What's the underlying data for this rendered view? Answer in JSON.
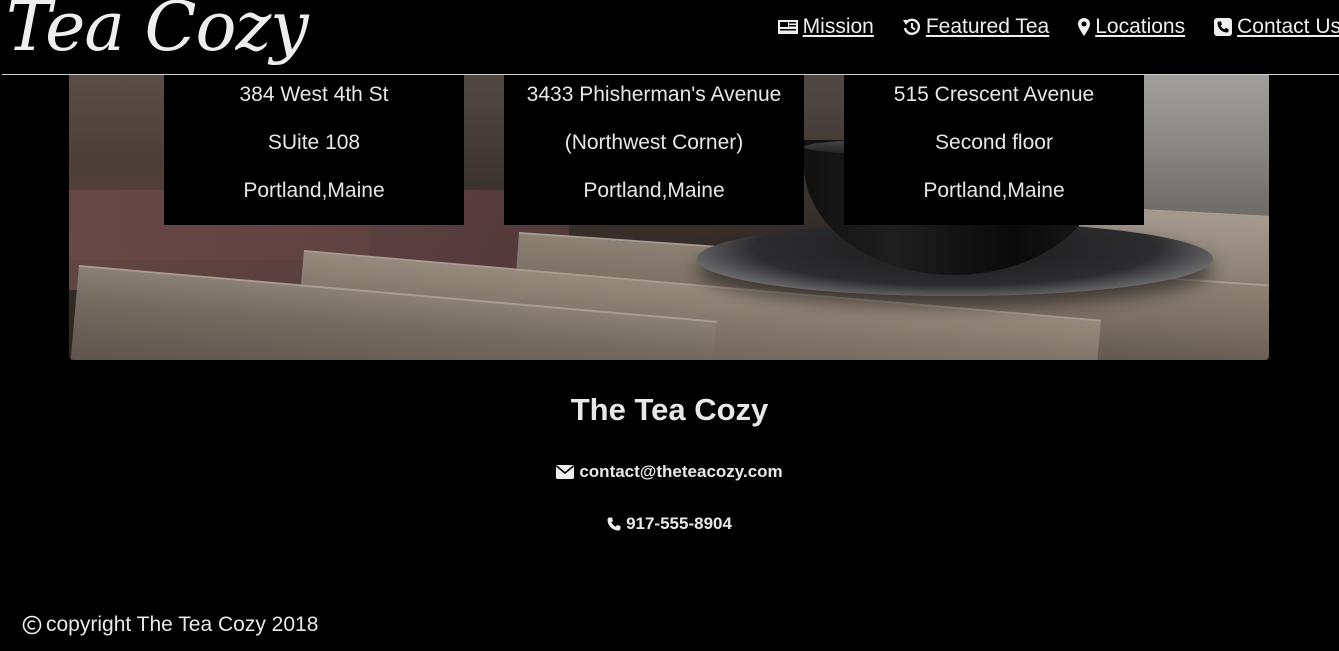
{
  "header": {
    "logo": "Tea Cozy",
    "nav": [
      {
        "label": "Mission",
        "icon": "newspaper-icon"
      },
      {
        "label": "Featured Tea",
        "icon": "history-icon"
      },
      {
        "label": "Locations",
        "icon": "map-marker-icon"
      },
      {
        "label": "Contact Us",
        "icon": "phone-square-icon"
      }
    ]
  },
  "locations": [
    {
      "lines": [
        "384 West 4th St",
        "SUite 108",
        "Portland,Maine"
      ]
    },
    {
      "lines": [
        "3433 Phisherman's Avenue",
        "(Northwest Corner)",
        "Portland,Maine"
      ]
    },
    {
      "lines": [
        "515 Crescent Avenue",
        "Second floor",
        "Portland,Maine"
      ]
    }
  ],
  "footer": {
    "title": "The Tea Cozy",
    "email": "contact@theteacozy.com",
    "phone": "917-555-8904",
    "copyright": "copyright The Tea Cozy 2018"
  }
}
